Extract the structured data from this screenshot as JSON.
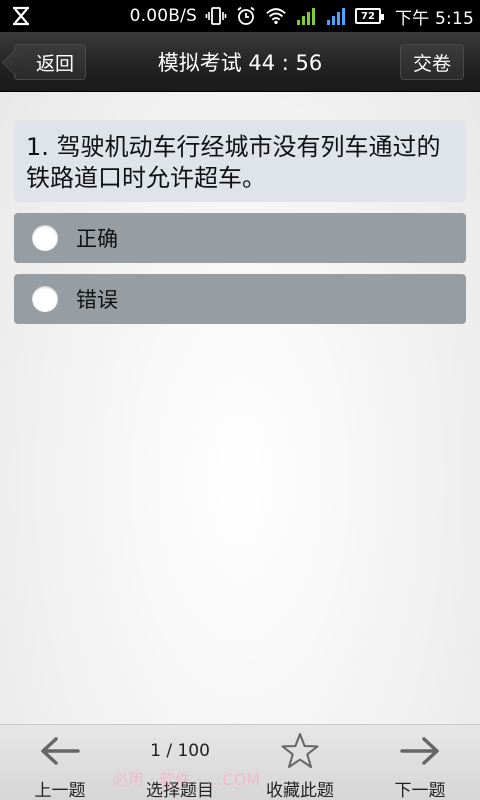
{
  "statusbar": {
    "speed": "0.00B/S",
    "battery": "72",
    "time": "下午 5:15"
  },
  "header": {
    "back_label": "返回",
    "title": "模拟考试 44 : 56",
    "submit_label": "交卷"
  },
  "question": {
    "text": "1. 驾驶机动车行经城市没有列车通过的铁路道口时允许超车。"
  },
  "options": [
    {
      "label": "正确",
      "selected": false
    },
    {
      "label": "错误",
      "selected": false
    }
  ],
  "footer": {
    "prev_label": "上一题",
    "progress": "1 / 100",
    "select_label": "选择题目",
    "favorite_label": "收藏此题",
    "next_label": "下一题",
    "watermark": "必用 · 软件 · …COM"
  },
  "icons": {
    "prev": "arrow-left-icon",
    "favorite": "star-outline-icon",
    "next": "arrow-right-icon"
  }
}
